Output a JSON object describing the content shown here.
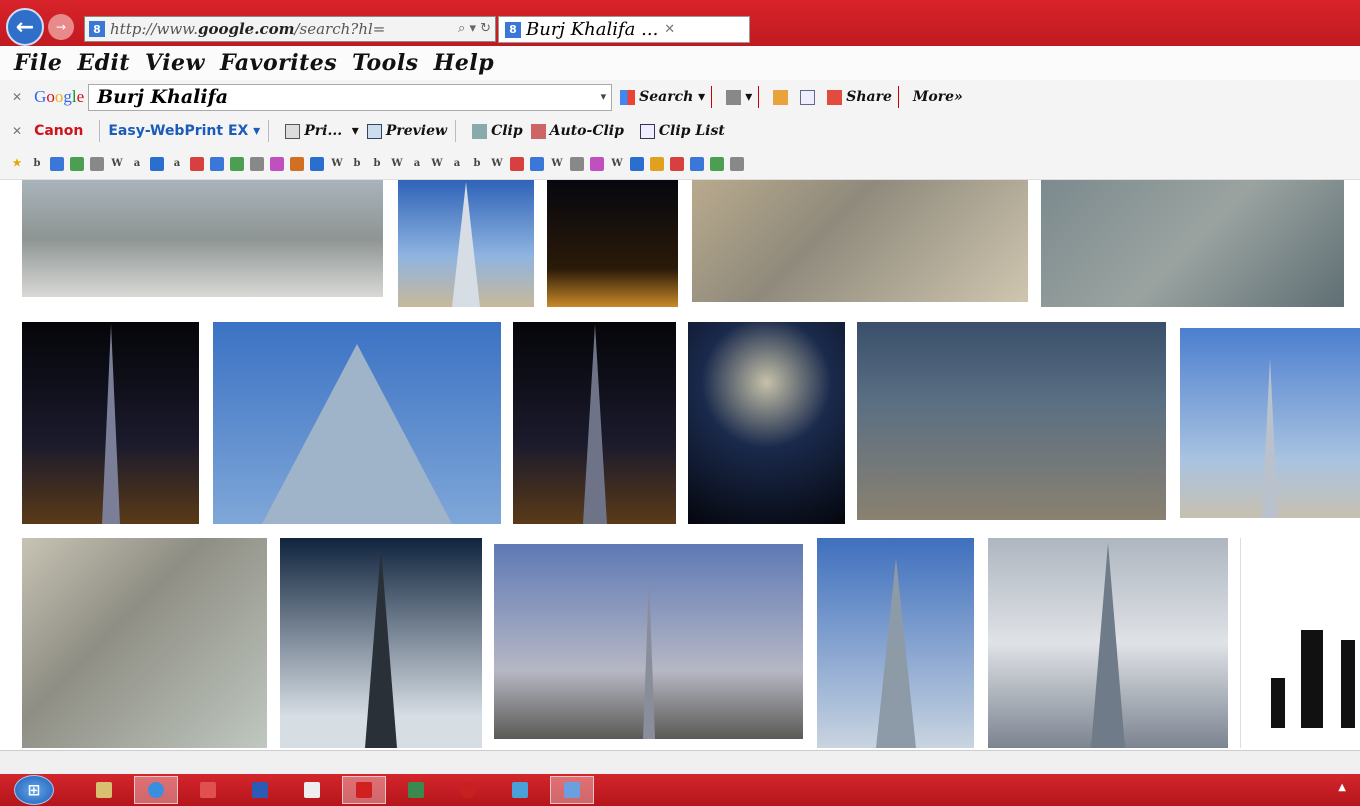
{
  "browser": {
    "url": "http://www.google.com/search?hl=",
    "url_domain": "google.com",
    "tab_title": "Burj Khalifa ...",
    "back_icon": "back-arrow-icon",
    "forward_icon": "forward-arrow-icon"
  },
  "menu": [
    "File",
    "Edit",
    "View",
    "Favorites",
    "Tools",
    "Help"
  ],
  "google_toolbar": {
    "logo": "Google",
    "query": "Burj Khalifa",
    "search_label": "Search",
    "share_label": "Share",
    "more_label": "More»"
  },
  "canon_toolbar": {
    "brand": "Canon",
    "app": "Easy-WebPrint EX",
    "print_label": "Pri...",
    "preview_label": "Preview",
    "clip_label": "Clip",
    "auto_clip_label": "Auto-Clip",
    "clip_list_label": "Clip List"
  },
  "favorites_icons": [
    "star",
    "b",
    "w",
    "i",
    "cloud",
    "W",
    "a",
    "K",
    "a",
    "i",
    "i",
    "i",
    "i",
    "i",
    "i",
    "i",
    "W",
    "b",
    "b",
    "W",
    "a",
    "W",
    "a",
    "b",
    "W",
    "i",
    "i",
    "W",
    "i",
    "i",
    "W",
    "i",
    "i",
    "i",
    "i",
    "i",
    "i"
  ],
  "results": {
    "images": [
      {
        "row": 1,
        "theme": "aerial-observation-deck"
      },
      {
        "row": 1,
        "theme": "tower-daytime"
      },
      {
        "row": 1,
        "theme": "tower-night-fountain"
      },
      {
        "row": 1,
        "theme": "aerial-from-top"
      },
      {
        "row": 1,
        "theme": "aerial-city"
      },
      {
        "row": 2,
        "theme": "tower-night-lights"
      },
      {
        "row": 2,
        "theme": "tower-glass-closeup"
      },
      {
        "row": 2,
        "theme": "tourists-night"
      },
      {
        "row": 2,
        "theme": "fireworks"
      },
      {
        "row": 2,
        "theme": "aerial-city-blue"
      },
      {
        "row": 2,
        "theme": "tower-skyline"
      },
      {
        "row": 3,
        "theme": "map-satellite"
      },
      {
        "row": 3,
        "theme": "tower-spotlights"
      },
      {
        "row": 3,
        "theme": "skyline-sunset"
      },
      {
        "row": 3,
        "theme": "tower-closeup-day"
      },
      {
        "row": 3,
        "theme": "tower-clouds"
      },
      {
        "row": 3,
        "theme": "height-comparison-chart"
      }
    ]
  },
  "taskbar": {
    "start_icon": "windows-start-icon",
    "items": [
      "explorer",
      "ie",
      "app1",
      "word",
      "pdf",
      "app2",
      "app3",
      "app4",
      "app5",
      "app6"
    ],
    "tray_arrow": "▲"
  }
}
